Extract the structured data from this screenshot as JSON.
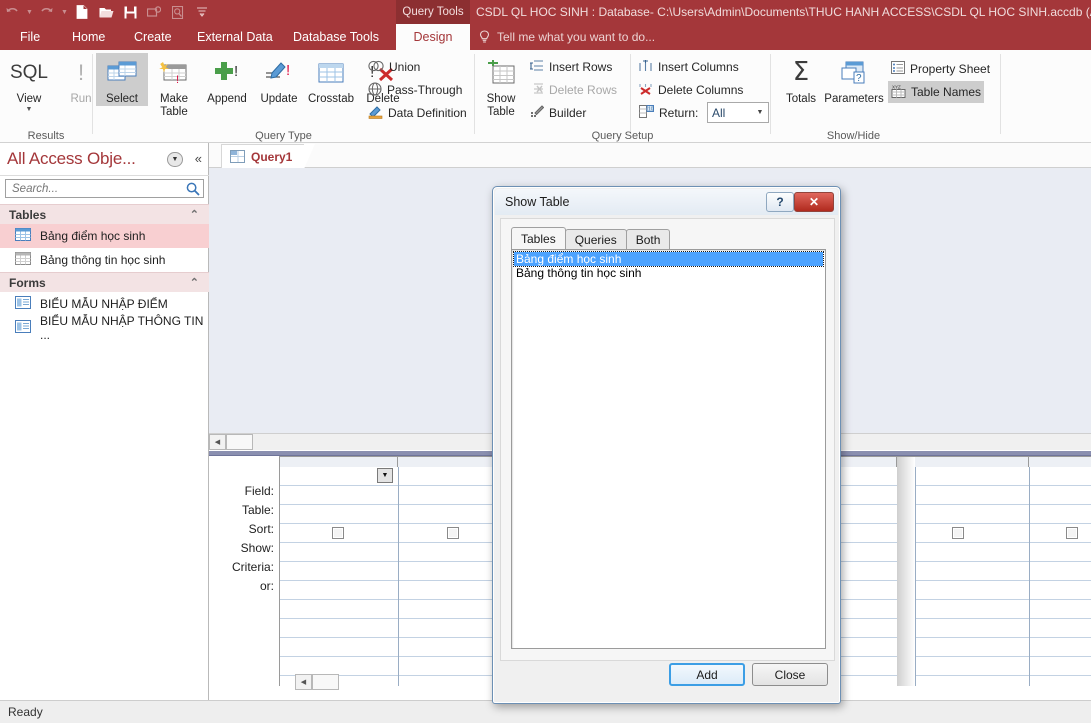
{
  "titlebar": {
    "document_title": "CSDL QL HOC SINH : Database- C:\\Users\\Admin\\Documents\\THUC HANH ACCESS\\CSDL QL HOC SINH.accdb (Acc",
    "contextual_tab_label": "Query Tools",
    "qat": [
      {
        "name": "undo-icon",
        "glyph": "↶",
        "disabled": true
      },
      {
        "name": "undo-dropdown-icon",
        "glyph": "▾",
        "disabled": true
      },
      {
        "name": "redo-icon",
        "glyph": "↷",
        "disabled": true
      },
      {
        "name": "redo-dropdown-icon",
        "glyph": "▾",
        "disabled": true
      },
      {
        "name": "new-file-icon",
        "glyph": "⬜",
        "disabled": false
      },
      {
        "name": "open-folder-icon",
        "glyph": "📁",
        "disabled": false
      },
      {
        "name": "save-icon",
        "glyph": "💾",
        "disabled": false
      },
      {
        "name": "email-icon",
        "glyph": "✉",
        "disabled": true
      },
      {
        "name": "print-preview-icon",
        "glyph": "🔍",
        "disabled": true
      },
      {
        "name": "customize-qat-icon",
        "glyph": "≡",
        "disabled": false
      }
    ]
  },
  "ribbon": {
    "tabs": [
      {
        "label": "File",
        "active": false
      },
      {
        "label": "Home",
        "active": false
      },
      {
        "label": "Create",
        "active": false
      },
      {
        "label": "External Data",
        "active": false
      },
      {
        "label": "Database Tools",
        "active": false
      },
      {
        "label": "Design",
        "active": true
      }
    ],
    "tell_me_placeholder": "Tell me what you want to do...",
    "groups": [
      {
        "name": "results",
        "label": "Results",
        "buttons": [
          {
            "label": "View",
            "icon": "sql-view-icon",
            "disabled": false,
            "has_dropdown": true
          },
          {
            "label": "Run",
            "icon": "run-exclamation-icon",
            "disabled": true,
            "has_dropdown": false
          }
        ]
      },
      {
        "name": "query-type",
        "label": "Query Type",
        "buttons": [
          {
            "label": "Select",
            "icon": "select-query-icon",
            "selected": true
          },
          {
            "label": "Make Table",
            "icon": "make-table-query-icon",
            "selected": false
          },
          {
            "label": "Append",
            "icon": "append-query-icon",
            "selected": false
          },
          {
            "label": "Update",
            "icon": "update-query-icon",
            "selected": false
          },
          {
            "label": "Crosstab",
            "icon": "crosstab-query-icon",
            "selected": false
          },
          {
            "label": "Delete",
            "icon": "delete-query-icon",
            "selected": false
          }
        ],
        "small_buttons": [
          {
            "label": "Union",
            "icon": "union-icon"
          },
          {
            "label": "Pass-Through",
            "icon": "pass-through-icon"
          },
          {
            "label": "Data Definition",
            "icon": "data-definition-icon"
          }
        ]
      },
      {
        "name": "query-setup",
        "label": "Query Setup",
        "buttons": [
          {
            "label": "Show Table",
            "icon": "show-table-icon",
            "disabled": false
          }
        ],
        "small_buttons": [
          {
            "label": "Insert Rows",
            "icon": "insert-rows-icon",
            "disabled": false
          },
          {
            "label": "Delete Rows",
            "icon": "delete-rows-icon",
            "disabled": true
          },
          {
            "label": "Builder",
            "icon": "builder-icon",
            "disabled": false
          },
          {
            "label": "Insert Columns",
            "icon": "insert-columns-icon",
            "disabled": false
          },
          {
            "label": "Delete Columns",
            "icon": "delete-columns-icon",
            "disabled": false
          },
          {
            "label": "Return:",
            "icon": "return-rows-icon",
            "disabled": false
          }
        ],
        "return_value": "All"
      },
      {
        "name": "show-hide",
        "label": "Show/Hide",
        "buttons": [
          {
            "label": "Totals",
            "icon": "sigma-totals-icon",
            "selected": false
          },
          {
            "label": "Parameters",
            "icon": "parameters-icon",
            "selected": false
          }
        ],
        "small_buttons": [
          {
            "label": "Property Sheet",
            "icon": "property-sheet-icon",
            "selected": false
          },
          {
            "label": "Table Names",
            "icon": "table-names-icon",
            "selected": true
          }
        ]
      }
    ]
  },
  "nav_pane": {
    "title": "All Access Obje...",
    "dropdown_icon": "chevron-down-icon",
    "collapse_icon": "double-chevron-left-icon",
    "search_placeholder": "Search...",
    "search_value": "",
    "search_icon": "search-icon",
    "groups": [
      {
        "label": "Tables",
        "collapse_icon": "chevron-up-icon",
        "items": [
          {
            "label": "Bảng điểm học sinh",
            "icon": "table-icon",
            "selected": true
          },
          {
            "label": "Bảng thông tin học sinh",
            "icon": "table-icon",
            "selected": false
          }
        ]
      },
      {
        "label": "Forms",
        "collapse_icon": "chevron-up-icon",
        "items": [
          {
            "label": "BIỂU MẪU NHẬP ĐIỂM",
            "icon": "form-icon",
            "selected": false
          },
          {
            "label": "BIỂU MẪU NHẬP THÔNG TIN ...",
            "icon": "form-icon",
            "selected": false
          }
        ]
      }
    ]
  },
  "query_designer": {
    "tab_label": "Query1",
    "tab_icon": "query-design-icon",
    "grid_row_labels": [
      "Field:",
      "Table:",
      "Sort:",
      "Show:",
      "Criteria:",
      "or:"
    ],
    "scroll_left_icon": "scroll-left-arrow-icon",
    "field_dropdown_icon": "chevron-down-icon"
  },
  "status_bar": {
    "text": "Ready"
  },
  "show_table_dialog": {
    "title": "Show Table",
    "help_button": "?",
    "close_button": "✕",
    "tabs": [
      {
        "label": "Tables",
        "active": true
      },
      {
        "label": "Queries",
        "active": false
      },
      {
        "label": "Both",
        "active": false
      }
    ],
    "list_items": [
      {
        "label": "Bảng điểm học sinh",
        "selected": true
      },
      {
        "label": "Bảng thông tin học sinh",
        "selected": false
      }
    ],
    "add_button": "Add",
    "close_button_label": "Close"
  },
  "colors": {
    "brand_red": "#a4373a",
    "contextual_red": "#8c2f31",
    "selection_pink": "#f8cfd1",
    "list_selection_blue": "#4da3ff"
  }
}
